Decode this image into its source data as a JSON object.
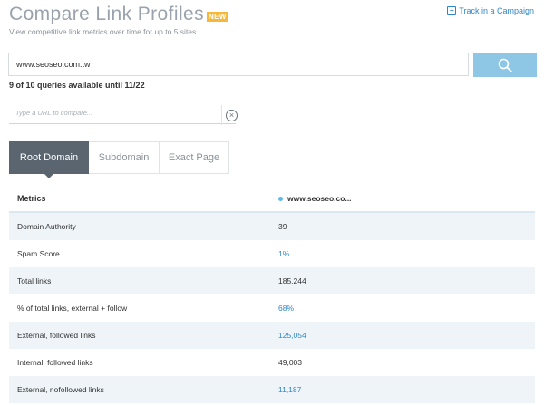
{
  "header": {
    "title": "Compare Link Profiles",
    "badge": "NEW",
    "subtitle": "View competitive link metrics over time for up to 5 sites.",
    "track_label": "Track in a Campaign",
    "track_icon": "plus-square-icon"
  },
  "search": {
    "url_value": "www.seoseo.com.tw",
    "button_icon": "search-icon",
    "quota": "9 of 10 queries available until 11/22"
  },
  "compare": {
    "placeholder": "Type a URL to compare...",
    "clear_icon": "close-circle-icon"
  },
  "tabs": [
    {
      "label": "Root Domain",
      "active": true
    },
    {
      "label": "Subdomain",
      "active": false
    },
    {
      "label": "Exact Page",
      "active": false
    }
  ],
  "table": {
    "header_metric": "Metrics",
    "header_site": "www.seoseo.co...",
    "series_color": "#5fb8e6",
    "link_color": "#2e86c8",
    "rows": [
      {
        "metric": "Domain Authority",
        "value": "39"
      },
      {
        "metric": "Spam Score",
        "value": "1%"
      },
      {
        "metric": "Total links",
        "value": "185,244"
      },
      {
        "metric": "% of total links, external + follow",
        "value": "68%"
      },
      {
        "metric": "External, followed links",
        "value": "125,054"
      },
      {
        "metric": "Internal, followed links",
        "value": "49,003"
      },
      {
        "metric": "External, nofollowed links",
        "value": "11,187"
      }
    ]
  }
}
